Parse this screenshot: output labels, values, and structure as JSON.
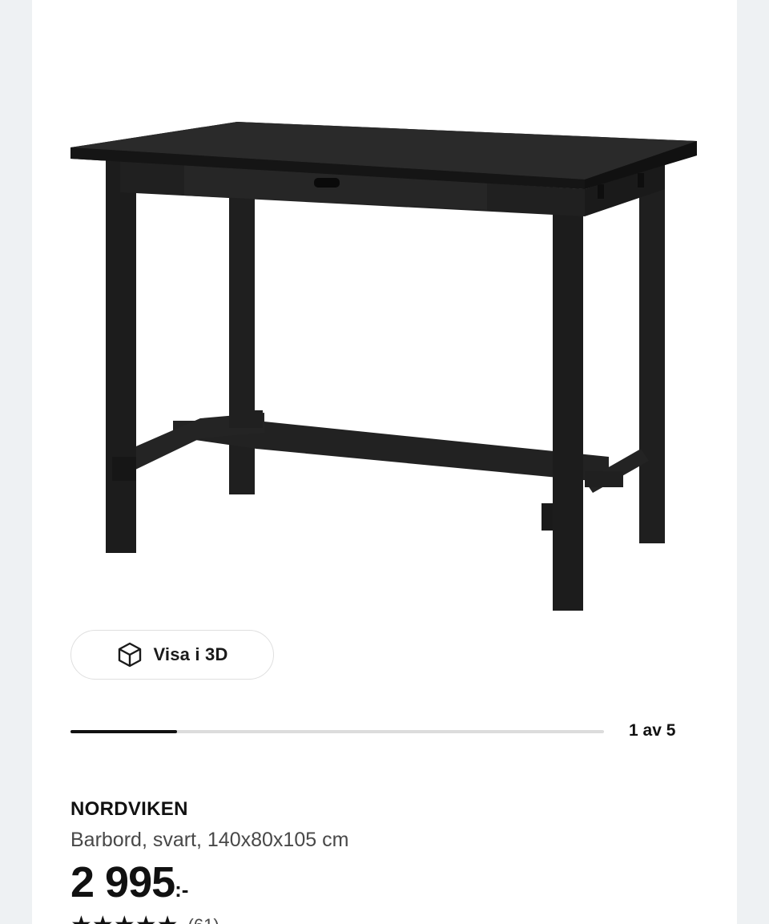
{
  "gallery": {
    "view_3d_label": "Visa i 3D",
    "view_3d_icon": "cube-icon",
    "page_counter": "1 av 5",
    "progress_fraction": 0.2
  },
  "product": {
    "name": "NORDVIKEN",
    "description": "Barbord, svart, 140x80x105 cm",
    "price_amount": "2 995",
    "price_suffix": ":-",
    "rating_stars": 5,
    "rating_count": "(61)"
  },
  "colors": {
    "page_background": "#eef1f3",
    "card_background": "#ffffff",
    "furniture": "#1b1b1b",
    "progress_track": "#dcdcdc",
    "progress_fill": "#111111"
  }
}
